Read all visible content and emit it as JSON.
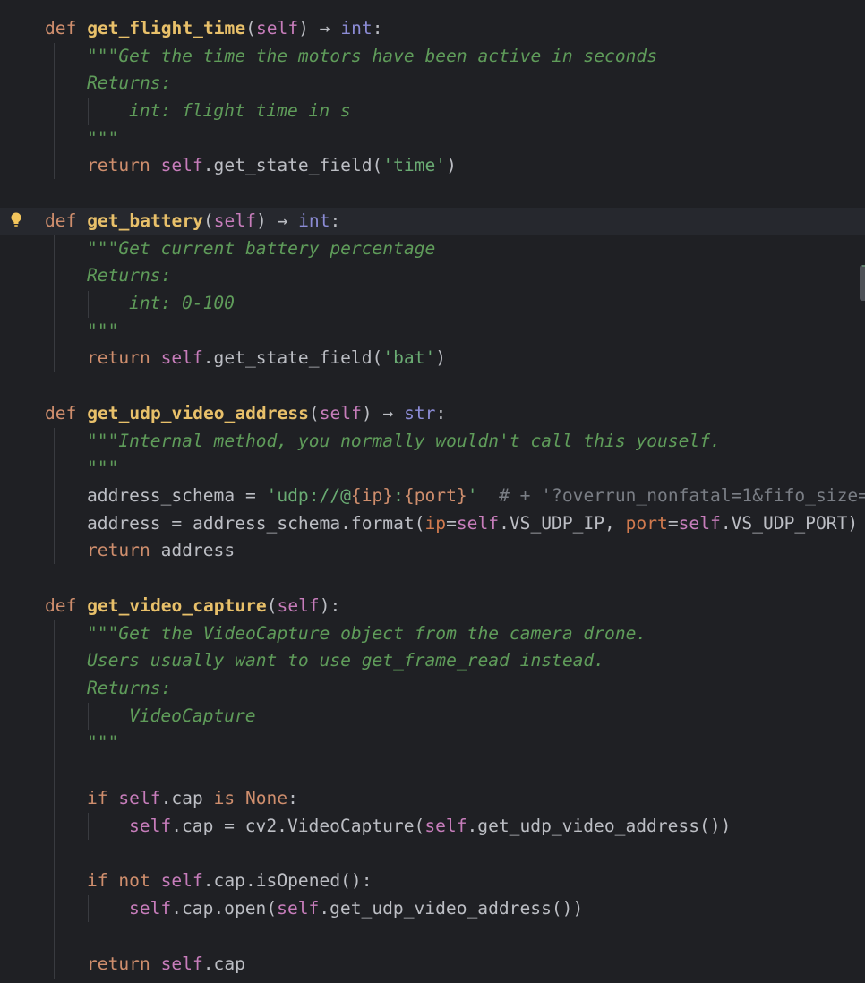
{
  "colors": {
    "background": "#1f2024",
    "keyword": "#cf8e6d",
    "function_name": "#e8c06a",
    "self": "#c77dbb",
    "docstring": "#5f9c5a",
    "string": "#6aab73",
    "comment": "#7a7e85",
    "type": "#8c8cd6",
    "named_param": "#d17a4e",
    "text": "#bcbec4"
  },
  "icons": {
    "intention_bulb": "lightbulb-icon"
  },
  "code": {
    "l1": {
      "kw": "def",
      "name": "get_flight_time",
      "p1": "(",
      "self": "self",
      "p2": ") → ",
      "type": "int",
      "end": ":"
    },
    "l2": {
      "doc": "\"\"\"Get the time the motors have been active in seconds"
    },
    "l3": {
      "doc": "Returns:"
    },
    "l4": {
      "doc": "int: flight time in s"
    },
    "l5": {
      "doc": "\"\"\""
    },
    "l6": {
      "kw": "return",
      "sp": " ",
      "self": "self",
      "rest": ".get_state_field(",
      "str": "'time'",
      "end": ")"
    },
    "l8": {
      "kw": "def",
      "name": "get_battery",
      "p1": "(",
      "self": "self",
      "p2": ") → ",
      "type": "int",
      "end": ":"
    },
    "l9": {
      "doc": "\"\"\"Get current battery percentage"
    },
    "l10": {
      "doc": "Returns:"
    },
    "l11": {
      "doc": "int: 0-100"
    },
    "l12": {
      "doc": "\"\"\""
    },
    "l13": {
      "kw": "return",
      "sp": " ",
      "self": "self",
      "rest": ".get_state_field(",
      "str": "'bat'",
      "end": ")"
    },
    "l15": {
      "kw": "def",
      "name": "get_udp_video_address",
      "p1": "(",
      "self": "self",
      "p2": ") → ",
      "type": "str",
      "end": ":"
    },
    "l16": {
      "doc": "\"\"\"Internal method, you normally wouldn't call this youself."
    },
    "l17": {
      "doc": "\"\"\""
    },
    "l18": {
      "a": "address_schema = ",
      "s1": "'udp://@",
      "f1": "{ip}",
      "s2": ":",
      "f2": "{port}",
      "s3": "'",
      "cm": "  # + '?overrun_nonfatal=1&fifo_size="
    },
    "l19": {
      "a": "address = address_schema.format(",
      "p1": "ip",
      "eq1": "=",
      "self1": "self",
      "b": ".VS_UDP_IP, ",
      "p2": "port",
      "eq2": "=",
      "self2": "self",
      "c": ".VS_UDP_PORT)"
    },
    "l20": {
      "kw": "return",
      "rest": " address"
    },
    "l22": {
      "kw": "def",
      "name": "get_video_capture",
      "p1": "(",
      "self": "self",
      "end": "):"
    },
    "l23": {
      "doc": "\"\"\"Get the VideoCapture object from the camera drone."
    },
    "l24": {
      "doc": "Users usually want to use get_frame_read instead."
    },
    "l25": {
      "doc": "Returns:"
    },
    "l26": {
      "doc": "VideoCapture"
    },
    "l27": {
      "doc": "\"\"\""
    },
    "l29": {
      "kw": "if",
      "sp": " ",
      "self": "self",
      "a": ".cap ",
      "kw2": "is",
      "sp2": " ",
      "kw3": "None",
      "end": ":"
    },
    "l30": {
      "self": "self",
      "a": ".cap = cv2.VideoCapture(",
      "self2": "self",
      "b": ".get_udp_video_address())"
    },
    "l32": {
      "kw": "if",
      "sp": " ",
      "kw2": "not",
      "sp2": " ",
      "self": "self",
      "a": ".cap.isOpened():"
    },
    "l33": {
      "self": "self",
      "a": ".cap.open(",
      "self2": "self",
      "b": ".get_udp_video_address())"
    },
    "l35": {
      "kw": "return",
      "sp": " ",
      "self": "self",
      "a": ".cap"
    }
  }
}
